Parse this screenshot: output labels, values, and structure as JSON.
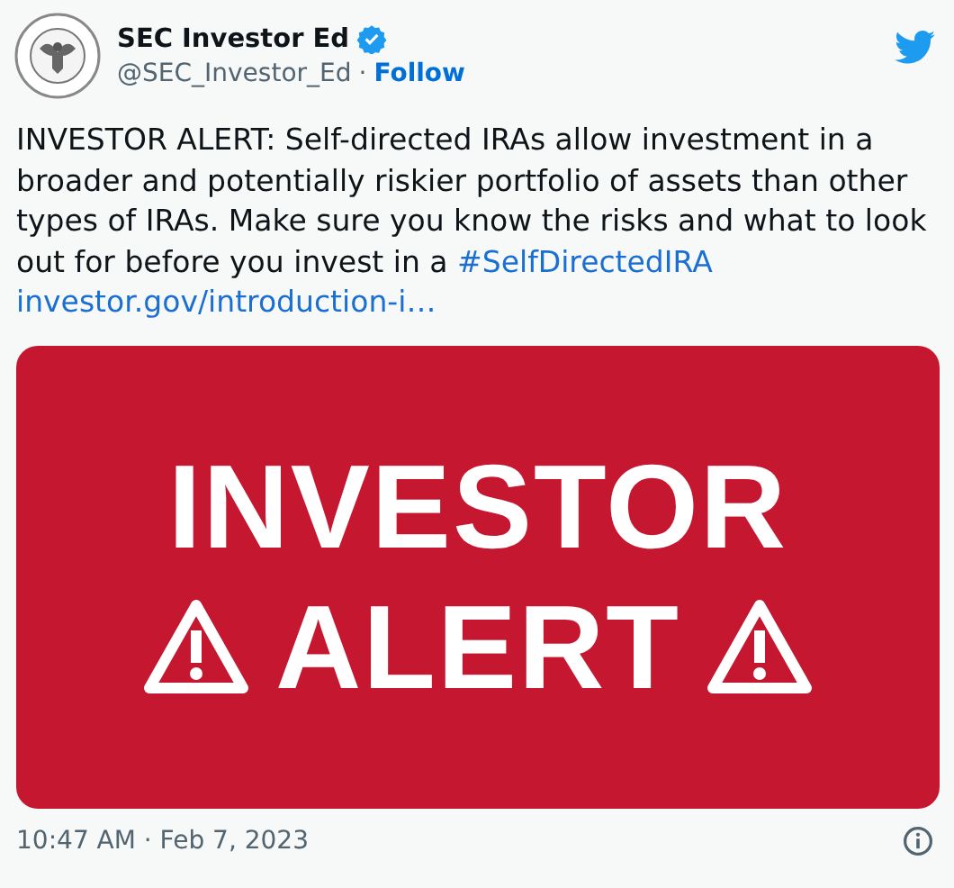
{
  "author": {
    "name": "SEC Investor Ed",
    "verified": true,
    "handle": "@SEC_Investor_Ed",
    "separator": "·",
    "follow": "Follow"
  },
  "tweet": {
    "text": "INVESTOR ALERT: Self-directed IRAs allow investment in a broader and potentially riskier portfolio of assets than other types of IRAs. Make sure you know the risks and what to look out for before you invest in a",
    "hashtag": "#SelfDirectedIRA",
    "link": "investor.gov/introduction-i…"
  },
  "media": {
    "line_1": "INVESTOR",
    "line_2": "ALERT"
  },
  "footer": {
    "timestamp": "10:47 AM · Feb 7, 2023"
  }
}
